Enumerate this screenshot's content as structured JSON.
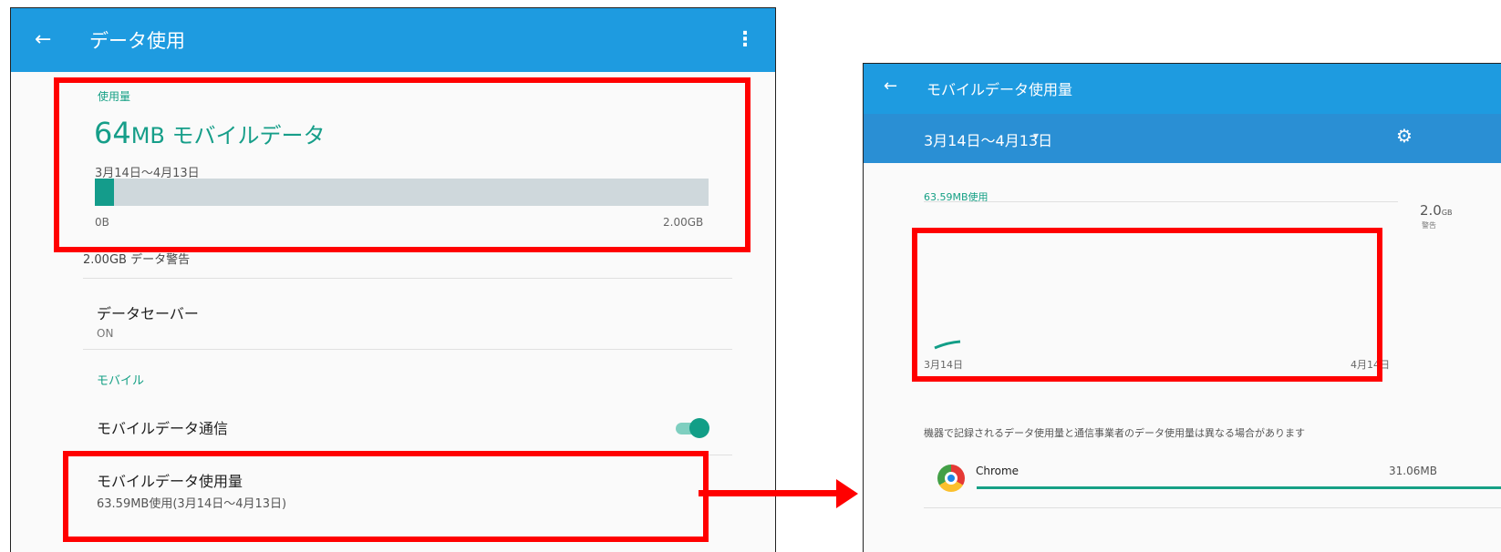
{
  "left": {
    "appbar": {
      "back_icon": "←",
      "title": "データ使用",
      "menu_icon": "⋮"
    },
    "usage": {
      "label": "使用量",
      "amount_number": "64",
      "amount_text": "MB モバイルデータ",
      "period": "3月14日〜4月13日",
      "fraction_used": 0.031,
      "bar_min": "0B",
      "bar_max": "2.00GB"
    },
    "warning": "2.00GB データ警告",
    "data_saver": {
      "title": "データセーバー",
      "status": "ON"
    },
    "mobile_section": "モバイル",
    "mobile_data": {
      "title": "モバイルデータ通信",
      "enabled": true
    },
    "mobile_usage_item": {
      "title": "モバイルデータ使用量",
      "subtitle": "63.59MB使用(3月14日〜4月13日)"
    }
  },
  "right": {
    "appbar": {
      "back_icon": "←",
      "title": "モバイルデータ使用量"
    },
    "subbar": {
      "range": "3月14日〜4月13日",
      "dropdown_icon": "▾",
      "gear_icon": "⚙"
    },
    "used_label": "63.59MB使用",
    "limit_value": "2.0",
    "limit_unit": "GB",
    "limit_note": "警告",
    "x_start": "3月14日",
    "x_end": "4月14日",
    "note": "機器で記録されるデータ使用量と通信事業者のデータ使用量は異なる場合があります",
    "apps": [
      {
        "name": "Chrome",
        "size": "31.06MB"
      }
    ]
  },
  "colors": {
    "appbar": "#1e9be0",
    "accent": "#149c8b",
    "highlight": "#ff0000"
  }
}
